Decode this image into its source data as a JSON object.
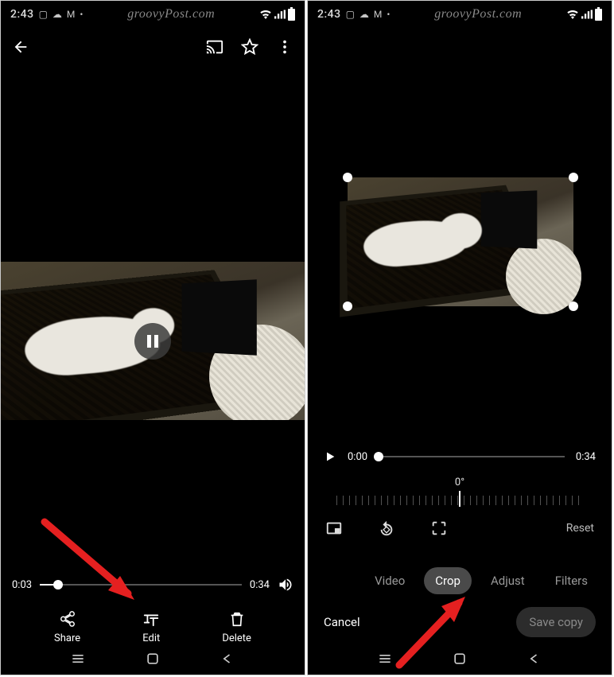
{
  "status": {
    "time": "2:43",
    "watermark": "groovyPost.com"
  },
  "left": {
    "play": {
      "current": "0:03",
      "total": "0:34",
      "progressPct": 9
    },
    "actions": {
      "share": "Share",
      "edit": "Edit",
      "delete": "Delete"
    }
  },
  "right": {
    "play": {
      "current": "0:00",
      "total": "0:34",
      "progressPct": 0
    },
    "angle": "0°",
    "reset": "Reset",
    "tabs": {
      "video": "Video",
      "crop": "Crop",
      "adjust": "Adjust",
      "filters": "Filters"
    },
    "cancel": "Cancel",
    "save": "Save copy"
  }
}
